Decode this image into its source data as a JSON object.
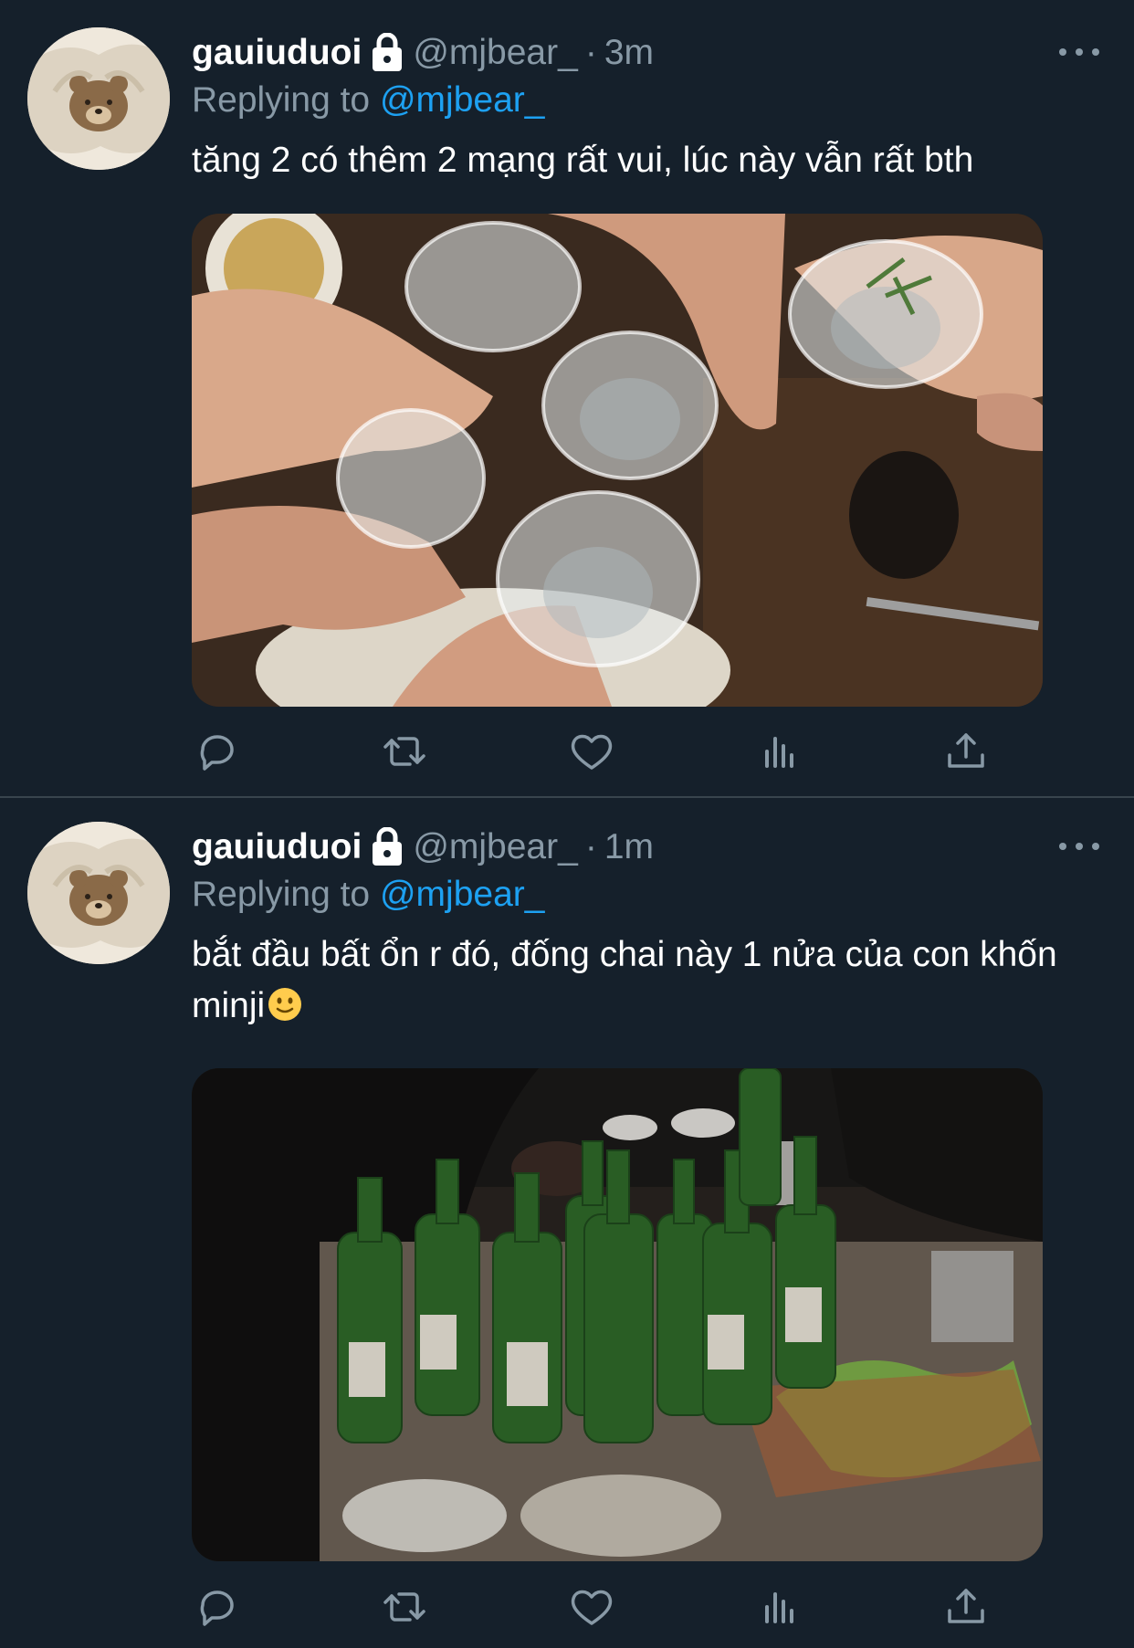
{
  "tweets": [
    {
      "author_name": "gauiuduoi",
      "handle": "@mjbear_",
      "separator": "·",
      "time": "3m",
      "replying_prefix": "Replying to ",
      "replying_handle": "@mjbear_",
      "text": "tăng 2 có thêm 2 mạng rất vui, lúc này vẫn rất bth",
      "media_icon": "photo-soju-glasses-toast"
    },
    {
      "author_name": "gauiuduoi",
      "handle": "@mjbear_",
      "separator": "·",
      "time": "1m",
      "replying_prefix": "Replying to ",
      "replying_handle": "@mjbear_",
      "text": "bắt đầu bất ổn r đó, đống chai này 1 nửa của con khốn minji",
      "text_emoji": "🙂",
      "media_icon": "photo-green-bottles-table"
    }
  ],
  "colors": {
    "background": "#15202b",
    "primary_text": "#ffffff",
    "secondary_text": "#8899a6",
    "accent_link": "#1da1f2",
    "divider": "#38444d"
  },
  "icons": {
    "lock": "lock-icon",
    "more": "more-horizontal-icon",
    "reply": "reply-icon",
    "retweet": "retweet-icon",
    "like": "heart-icon",
    "analytics": "analytics-icon",
    "share": "share-icon"
  }
}
